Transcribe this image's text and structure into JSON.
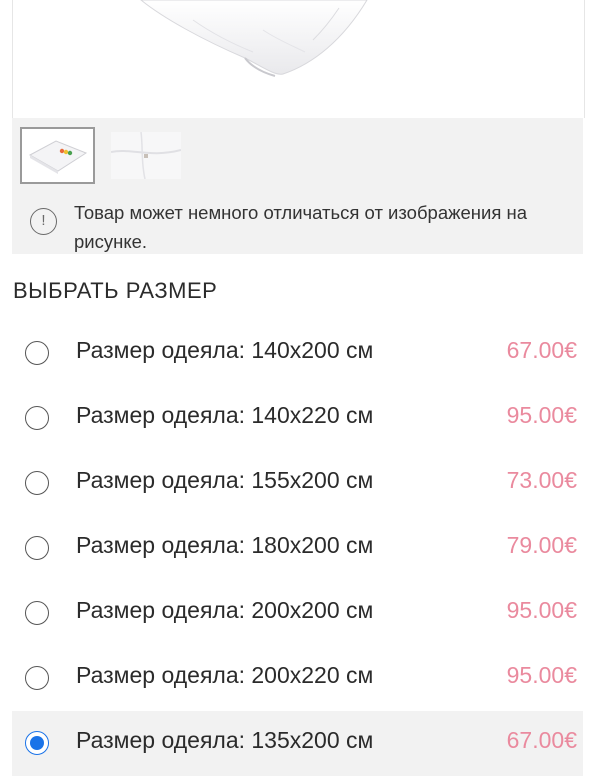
{
  "product_image": {
    "alt": "blanket",
    "thumbnails": [
      {
        "name": "thumbnail-1",
        "selected": true
      },
      {
        "name": "thumbnail-2",
        "selected": false
      }
    ]
  },
  "notice": {
    "icon": "info-exclamation-icon",
    "text": "Товар может немного отличаться от изображения на рисунке."
  },
  "size_section": {
    "title": "ВЫБРАТЬ РАЗМЕР",
    "price_color": "#ea8a9e",
    "selected_color": "#1a73e8",
    "options": [
      {
        "label": "Размер одеяла: 140x200 см",
        "price": "67.00€",
        "selected": false
      },
      {
        "label": "Размер одеяла: 140x220 см",
        "price": "95.00€",
        "selected": false
      },
      {
        "label": "Размер одеяла: 155x200 см",
        "price": "73.00€",
        "selected": false
      },
      {
        "label": "Размер одеяла: 180x200 см",
        "price": "79.00€",
        "selected": false
      },
      {
        "label": "Размер одеяла: 200x200 см",
        "price": "95.00€",
        "selected": false
      },
      {
        "label": "Размер одеяла: 200x220 см",
        "price": "95.00€",
        "selected": false
      },
      {
        "label": "Размер одеяла: 135x200 см",
        "price": "67.00€",
        "selected": true
      }
    ]
  }
}
